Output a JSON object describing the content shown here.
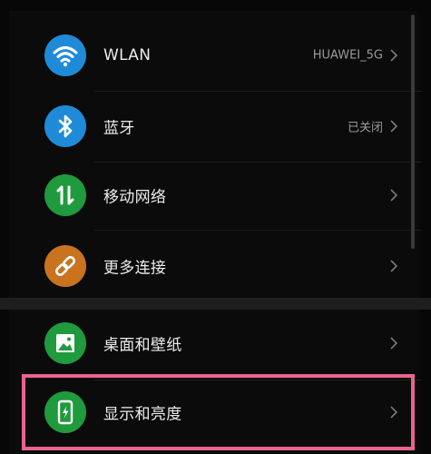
{
  "settings": {
    "rows": [
      {
        "label": "WLAN",
        "value": "HUAWEI_5G",
        "icon": "wifi-icon",
        "color": "#1f8bd8"
      },
      {
        "label": "蓝牙",
        "value": "已关闭",
        "icon": "bluetooth-icon",
        "color": "#1f8bd8"
      },
      {
        "label": "移动网络",
        "value": "",
        "icon": "mobile-data-icon",
        "color": "#1f9a3c"
      },
      {
        "label": "更多连接",
        "value": "",
        "icon": "link-icon",
        "color": "#c9731f"
      },
      {
        "label": "桌面和壁纸",
        "value": "",
        "icon": "image-icon",
        "color": "#1f9a3c"
      },
      {
        "label": "显示和亮度",
        "value": "",
        "icon": "phone-brightness-icon",
        "color": "#1f9a3c"
      }
    ]
  },
  "highlight": {
    "color": "#e8648f"
  }
}
